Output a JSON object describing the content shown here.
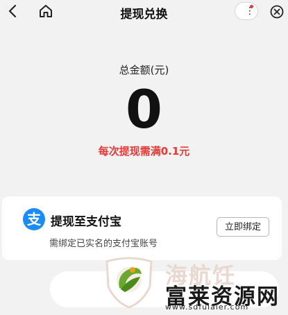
{
  "header": {
    "title": "提现兑换",
    "back_icon": "chevron-left-icon",
    "home_icon": "home-icon",
    "more_icon": "more-dots-icon",
    "close_icon": "close-circle-icon"
  },
  "balance": {
    "label": "总金额(元)",
    "amount": "0",
    "min_tip": "每次提现需满0.1元"
  },
  "withdraw_method": {
    "icon_glyph": "支",
    "title": "提现至支付宝",
    "subtitle": "需绑定已实名的支付宝账号",
    "bind_button": "立即绑定"
  },
  "watermark": {
    "ghost_text": "海航饪",
    "name": "富莱资源网",
    "url": "www.sdfulaier.com"
  },
  "colors": {
    "accent_red": "#e53935",
    "alipay_blue": "#1a8cf3",
    "background": "#f2f2f2"
  }
}
